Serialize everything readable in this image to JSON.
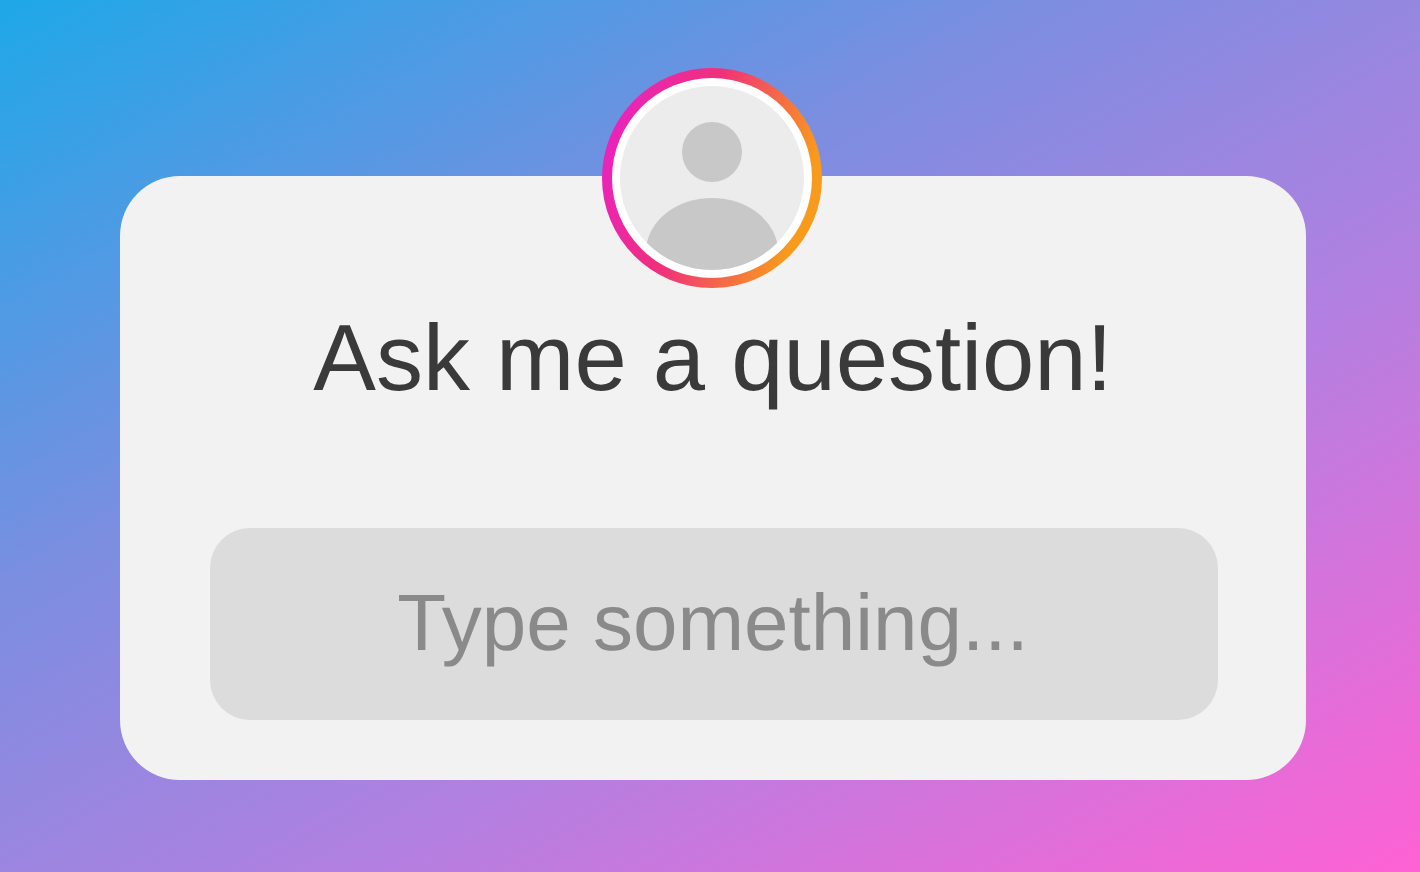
{
  "sticker": {
    "title": "Ask me a question!",
    "answer_field": {
      "placeholder": "Type something..."
    }
  }
}
